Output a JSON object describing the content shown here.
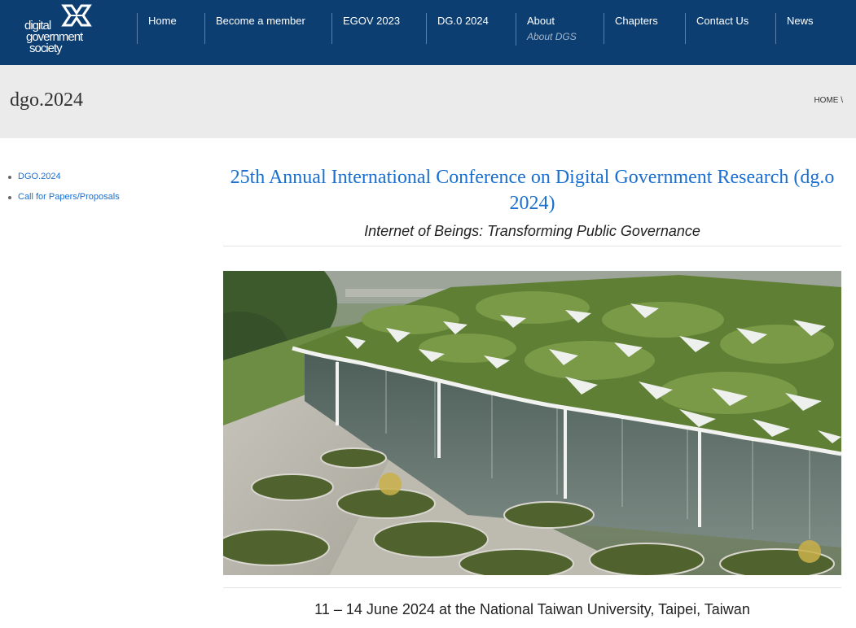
{
  "header": {
    "logo_lines": [
      "digital",
      "government",
      "society"
    ],
    "nav": [
      {
        "label": "Home"
      },
      {
        "label": "Become a member"
      },
      {
        "label": "EGOV 2023"
      },
      {
        "label": "DG.0 2024"
      },
      {
        "label": "About",
        "sub": "About DGS"
      },
      {
        "label": "Chapters"
      },
      {
        "label": "Contact Us"
      },
      {
        "label": "News"
      }
    ]
  },
  "band": {
    "title": "dgo.2024",
    "breadcrumb": "HOME \\"
  },
  "sidebar": {
    "items": [
      {
        "label": "DGO.2024"
      },
      {
        "label": "Call for Papers/Proposals"
      }
    ]
  },
  "main": {
    "title": "25th Annual International Conference on Digital Government Research (dg.o 2024)",
    "theme": "Internet of Beings: Transforming Public Governance",
    "dates": "11 – 14 June 2024 at the National Taiwan University, Taipei, Taiwan"
  },
  "colors": {
    "header_bg": "#0c3e72",
    "link": "#1a6fd0",
    "band_bg": "#ebebeb"
  }
}
